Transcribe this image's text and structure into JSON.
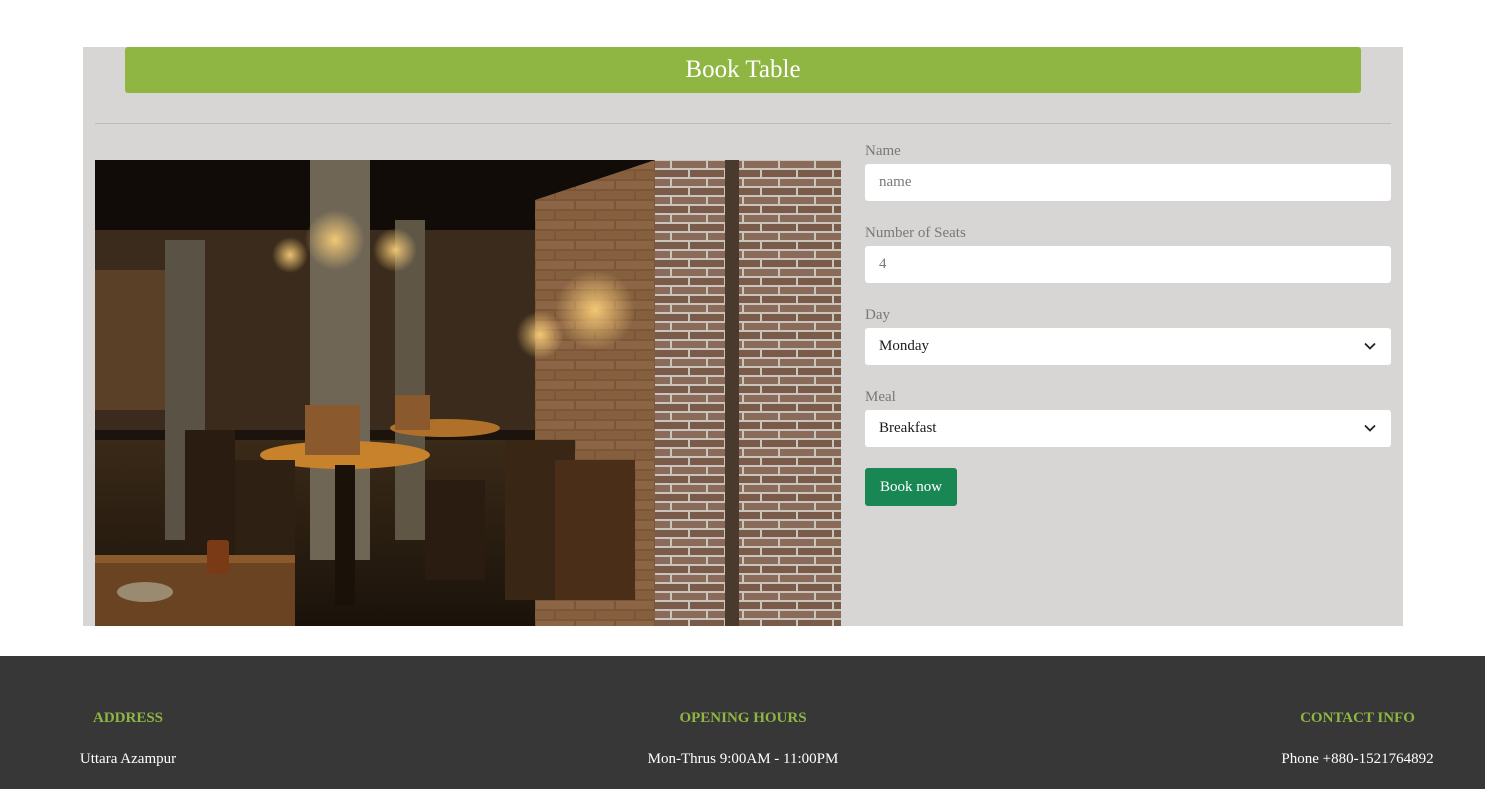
{
  "booking": {
    "title": "Book Table",
    "image_alt": "restaurant interior",
    "form": {
      "name": {
        "label": "Name",
        "placeholder": "name"
      },
      "seats": {
        "label": "Number of Seats",
        "placeholder": "4"
      },
      "day": {
        "label": "Day",
        "value": "Monday"
      },
      "meal": {
        "label": "Meal",
        "value": "Breakfast"
      },
      "submit_label": "Book now"
    }
  },
  "footer": {
    "address": {
      "heading": "ADDRESS",
      "text": "Uttara Azampur"
    },
    "hours": {
      "heading": "OPENING HOURS",
      "text": "Mon-Thrus 9:00AM - 11:00PM"
    },
    "contact": {
      "heading": "CONTACT INFO",
      "text": "Phone +880-1521764892"
    }
  },
  "colors": {
    "accent": "#8fb542",
    "button": "#198754",
    "panel": "#d8d5d5",
    "footer": "#373737"
  },
  "icons": {
    "select_arrow": "chevron-down-icon"
  }
}
